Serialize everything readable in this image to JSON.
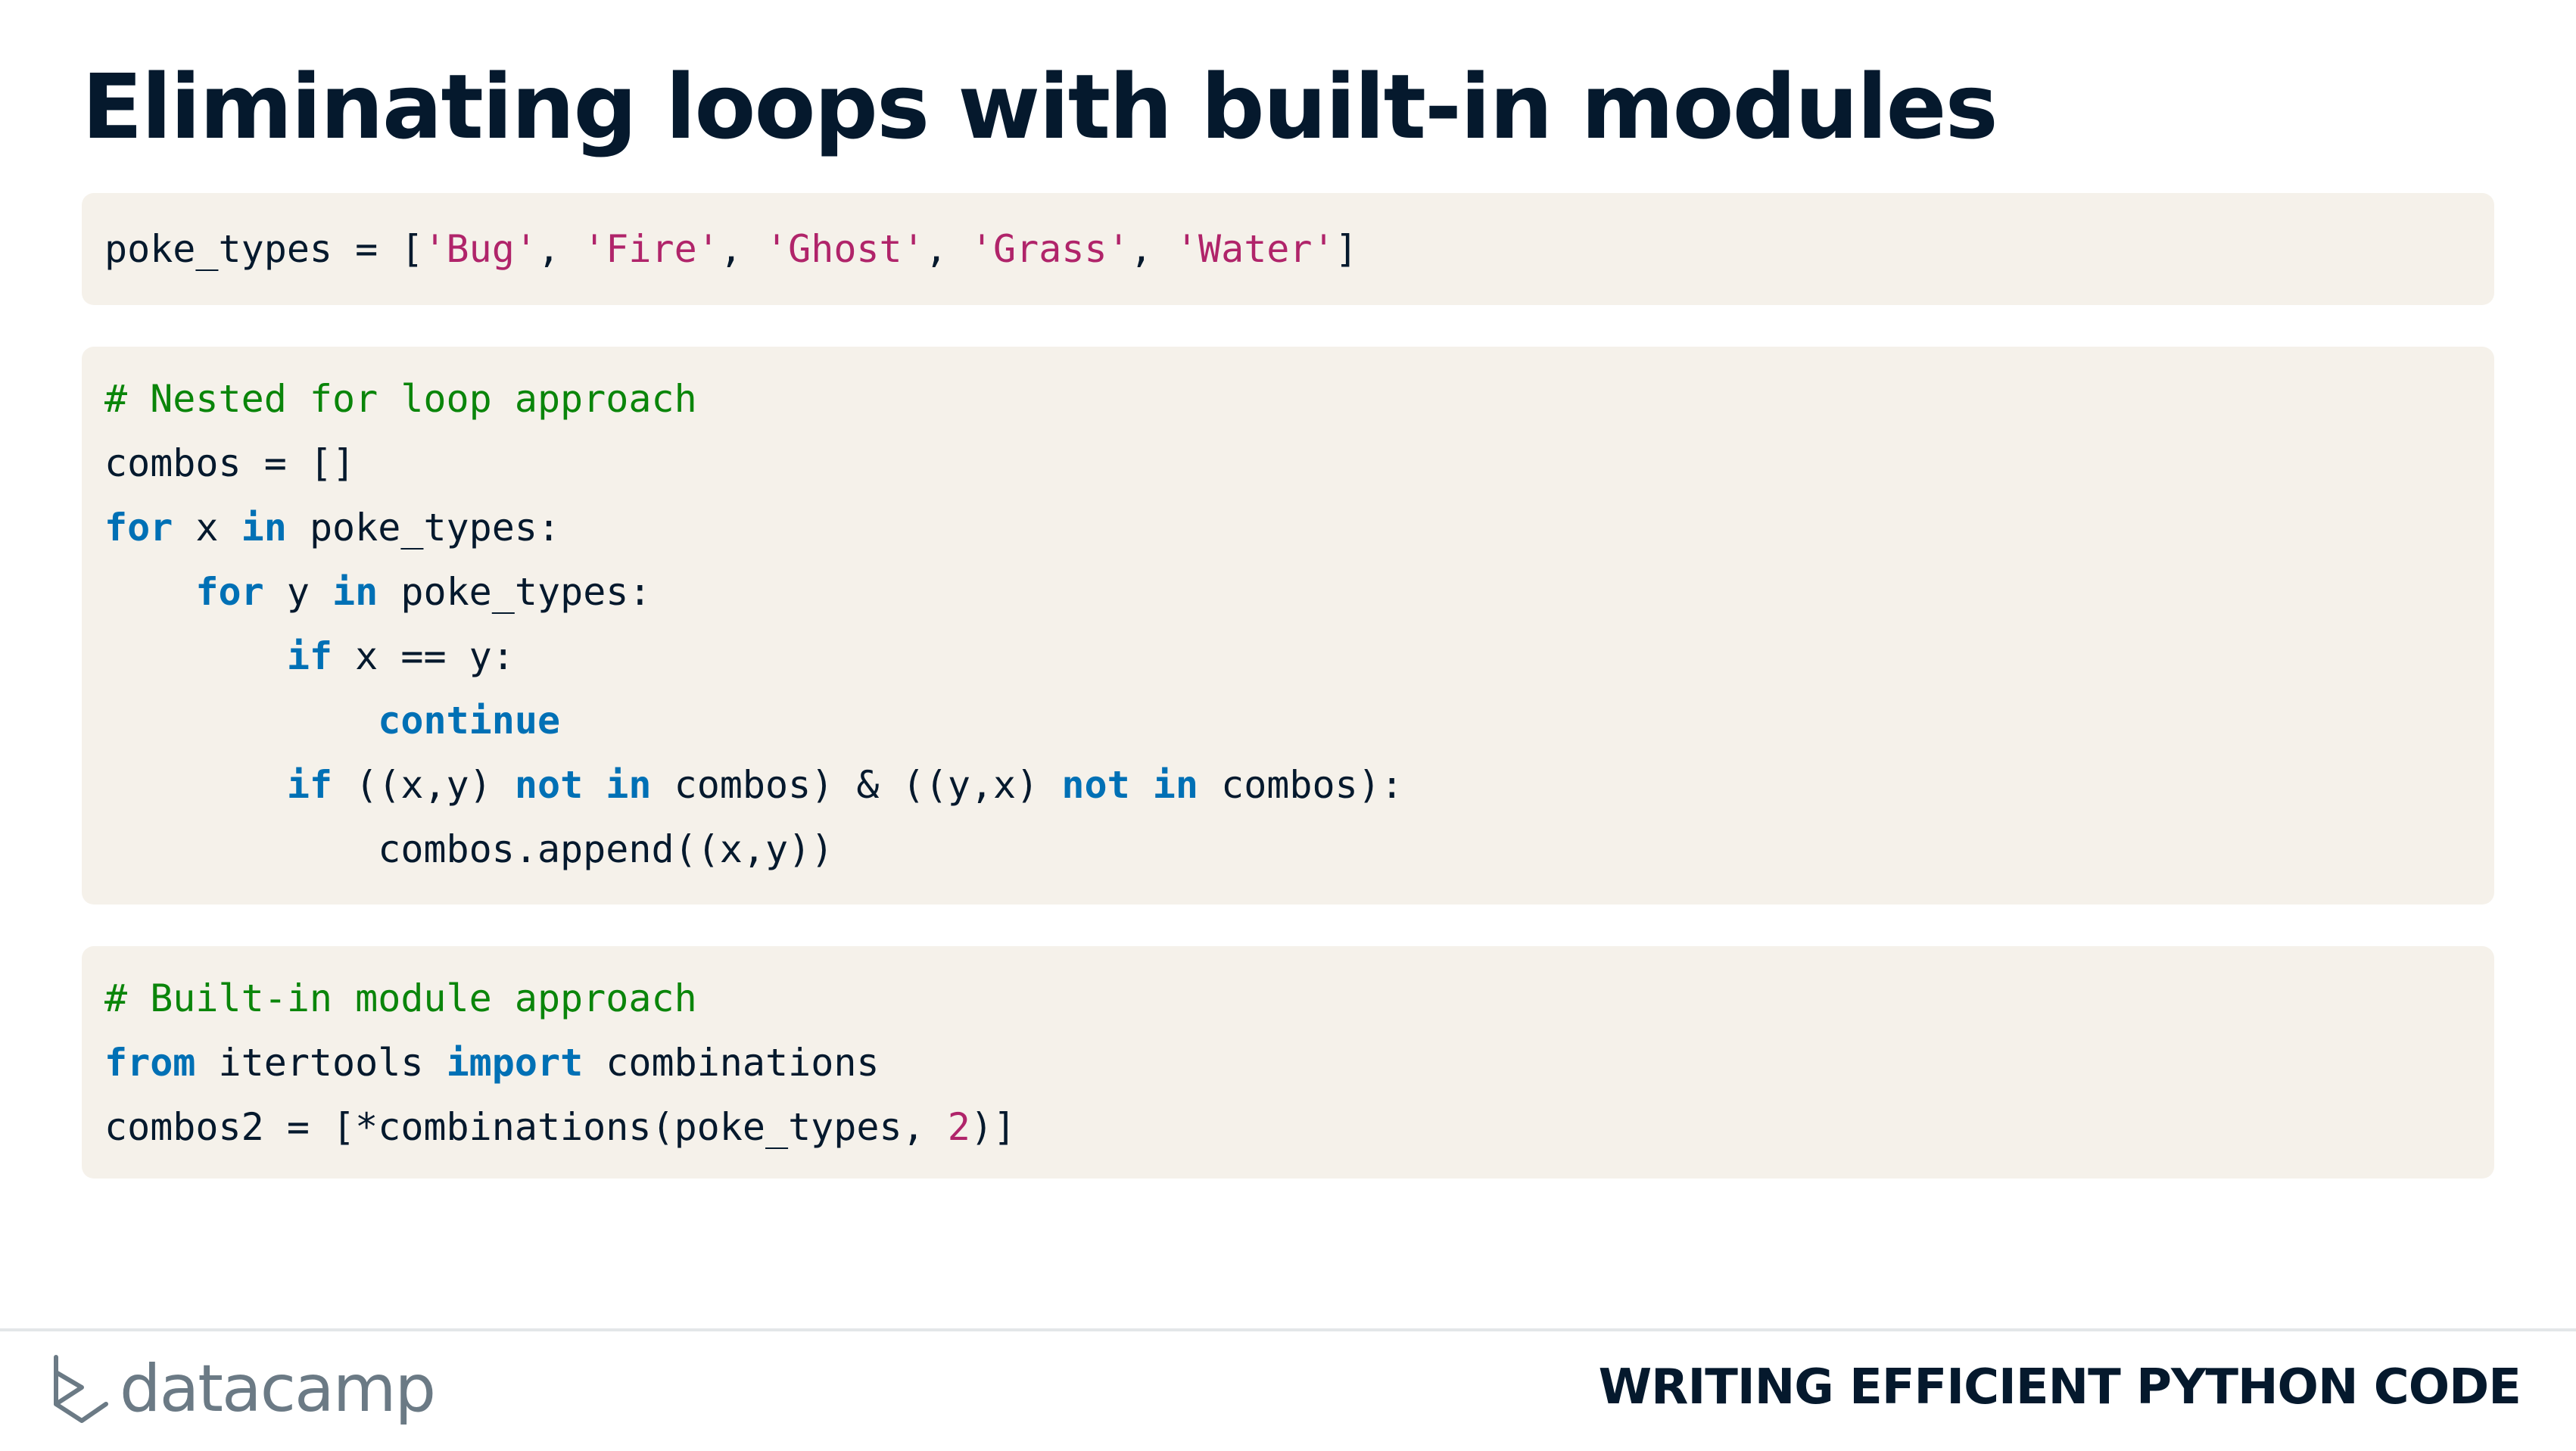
{
  "slide": {
    "title": "Eliminating loops with built-in modules"
  },
  "code_blocks": [
    {
      "lines": [
        [
          {
            "t": "plain",
            "v": "poke_types = ["
          },
          {
            "t": "str",
            "v": "'Bug'"
          },
          {
            "t": "plain",
            "v": ", "
          },
          {
            "t": "str",
            "v": "'Fire'"
          },
          {
            "t": "plain",
            "v": ", "
          },
          {
            "t": "str",
            "v": "'Ghost'"
          },
          {
            "t": "plain",
            "v": ", "
          },
          {
            "t": "str",
            "v": "'Grass'"
          },
          {
            "t": "plain",
            "v": ", "
          },
          {
            "t": "str",
            "v": "'Water'"
          },
          {
            "t": "plain",
            "v": "]"
          }
        ]
      ]
    },
    {
      "lines": [
        [
          {
            "t": "com",
            "v": "# Nested for loop approach"
          }
        ],
        [
          {
            "t": "plain",
            "v": "combos = []"
          }
        ],
        [
          {
            "t": "kw",
            "v": "for"
          },
          {
            "t": "plain",
            "v": " x "
          },
          {
            "t": "kw",
            "v": "in"
          },
          {
            "t": "plain",
            "v": " poke_types:"
          }
        ],
        [
          {
            "t": "plain",
            "v": "    "
          },
          {
            "t": "kw",
            "v": "for"
          },
          {
            "t": "plain",
            "v": " y "
          },
          {
            "t": "kw",
            "v": "in"
          },
          {
            "t": "plain",
            "v": " poke_types:"
          }
        ],
        [
          {
            "t": "plain",
            "v": "        "
          },
          {
            "t": "kw",
            "v": "if"
          },
          {
            "t": "plain",
            "v": " x == y:"
          }
        ],
        [
          {
            "t": "plain",
            "v": "            "
          },
          {
            "t": "kw",
            "v": "continue"
          }
        ],
        [
          {
            "t": "plain",
            "v": "        "
          },
          {
            "t": "kw",
            "v": "if"
          },
          {
            "t": "plain",
            "v": " ((x,y) "
          },
          {
            "t": "kw",
            "v": "not in"
          },
          {
            "t": "plain",
            "v": " combos) & ((y,x) "
          },
          {
            "t": "kw",
            "v": "not in"
          },
          {
            "t": "plain",
            "v": " combos):"
          }
        ],
        [
          {
            "t": "plain",
            "v": "            combos.append((x,y))"
          }
        ]
      ]
    },
    {
      "lines": [
        [
          {
            "t": "com",
            "v": "# Built-in module approach"
          }
        ],
        [
          {
            "t": "kw",
            "v": "from"
          },
          {
            "t": "plain",
            "v": " itertools "
          },
          {
            "t": "kw",
            "v": "import"
          },
          {
            "t": "plain",
            "v": " combinations"
          }
        ],
        [
          {
            "t": "plain",
            "v": "combos2 = [*combinations(poke_types, "
          },
          {
            "t": "num",
            "v": "2"
          },
          {
            "t": "plain",
            "v": ")]"
          }
        ]
      ]
    }
  ],
  "footer": {
    "logo_text": "datacamp",
    "logo_icon": "datacamp-logo-icon",
    "course_title": "WRITING EFFICIENT PYTHON CODE"
  },
  "colors": {
    "title": "#05192d",
    "code_background": "#f5f1ea",
    "keyword": "#0070b5",
    "string": "#b0246a",
    "comment": "#0a850a",
    "logo": "#6b7a85"
  }
}
